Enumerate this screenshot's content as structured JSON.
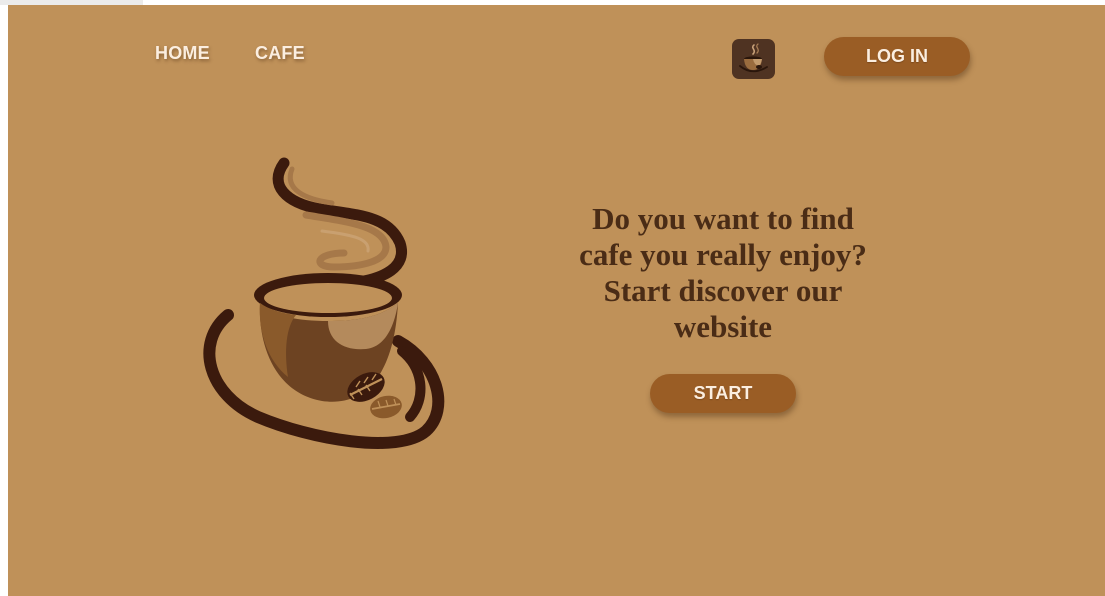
{
  "nav": {
    "home_label": "HOME",
    "cafe_label": "CAFE"
  },
  "header": {
    "app_icon": "coffee-cup-icon",
    "login_label": "LOG IN"
  },
  "hero": {
    "logo_icon": "coffee-cup-logo",
    "headline_lines": [
      "Do you want to find",
      "cafe you really enjoy?",
      "Start discover our",
      "website"
    ],
    "start_label": "START"
  },
  "colors": {
    "background": "#bf9159",
    "button": "#9a5d25",
    "button_text": "#fbeee0",
    "headline": "#4a2c16",
    "dark_brown": "#3b1a0d",
    "cup_brown": "#8a5a2b"
  }
}
